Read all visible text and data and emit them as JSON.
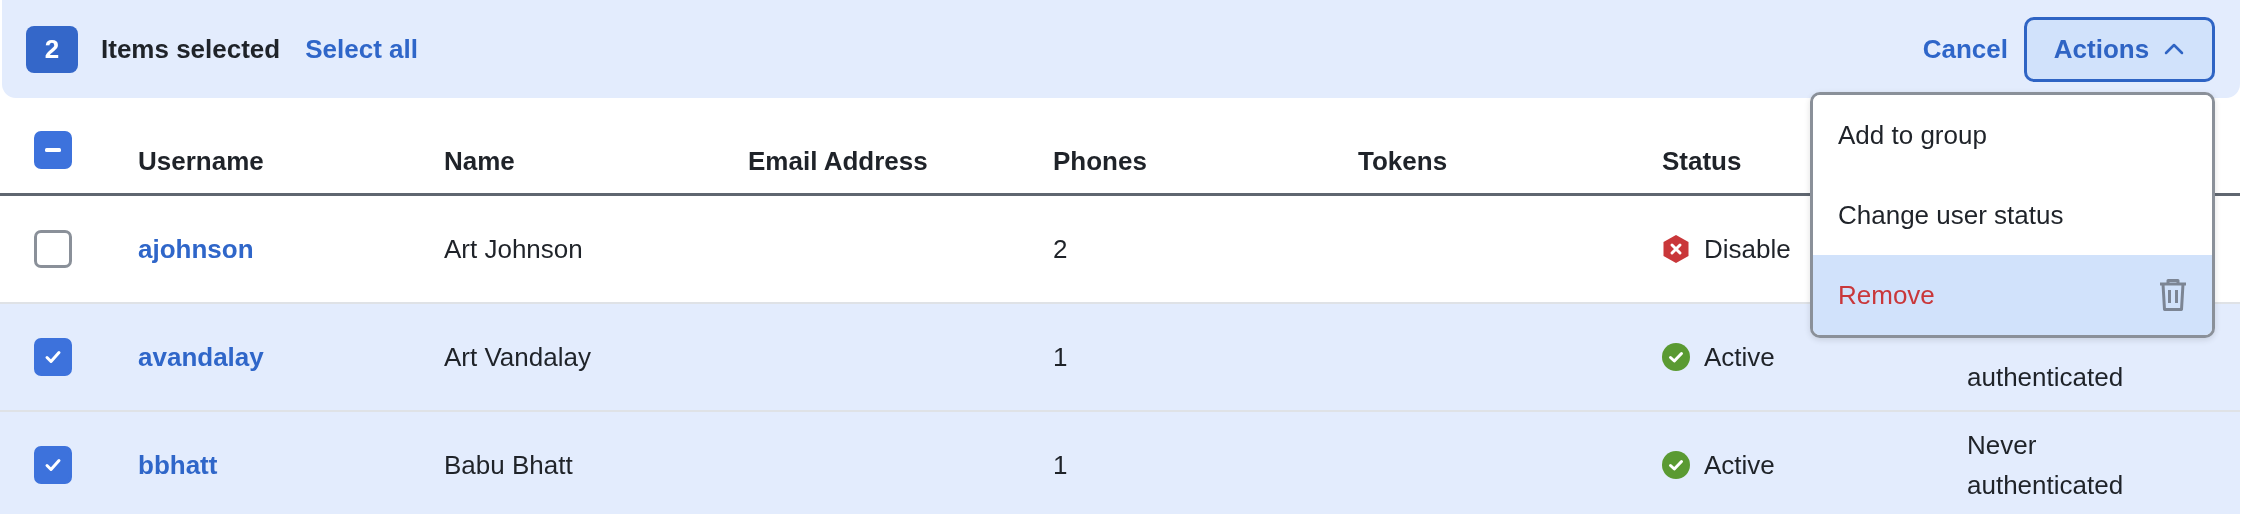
{
  "selection_bar": {
    "count": "2",
    "label": "Items selected",
    "select_all": "Select all",
    "cancel": "Cancel",
    "actions": {
      "label": "Actions",
      "expanded": true
    }
  },
  "table": {
    "header_checkbox": {
      "indeterminate": true
    },
    "columns": [
      "Username",
      "Name",
      "Email Address",
      "Phones",
      "Tokens",
      "Status"
    ],
    "rows": [
      {
        "selected": false,
        "username": "ajohnson",
        "name": "Art Johnson",
        "phones": "2",
        "status": {
          "kind": "disabled",
          "text": "Disable"
        }
      },
      {
        "selected": true,
        "username": "avandalay",
        "name": "Art Vandalay",
        "phones": "1",
        "status": {
          "kind": "active",
          "text": "Active"
        },
        "column_7": "authenticated"
      },
      {
        "selected": true,
        "username": "bbhatt",
        "name": "Babu Bhatt",
        "phones": "1",
        "status": {
          "kind": "active",
          "text": "Active"
        },
        "column_7": "Never authenticated"
      }
    ]
  },
  "actions_menu": {
    "items": [
      {
        "label": "Add to group",
        "kind": "normal",
        "highlighted": false
      },
      {
        "label": "Change user status",
        "kind": "normal",
        "highlighted": false
      },
      {
        "label": "Remove",
        "kind": "danger",
        "highlighted": true
      }
    ]
  }
}
